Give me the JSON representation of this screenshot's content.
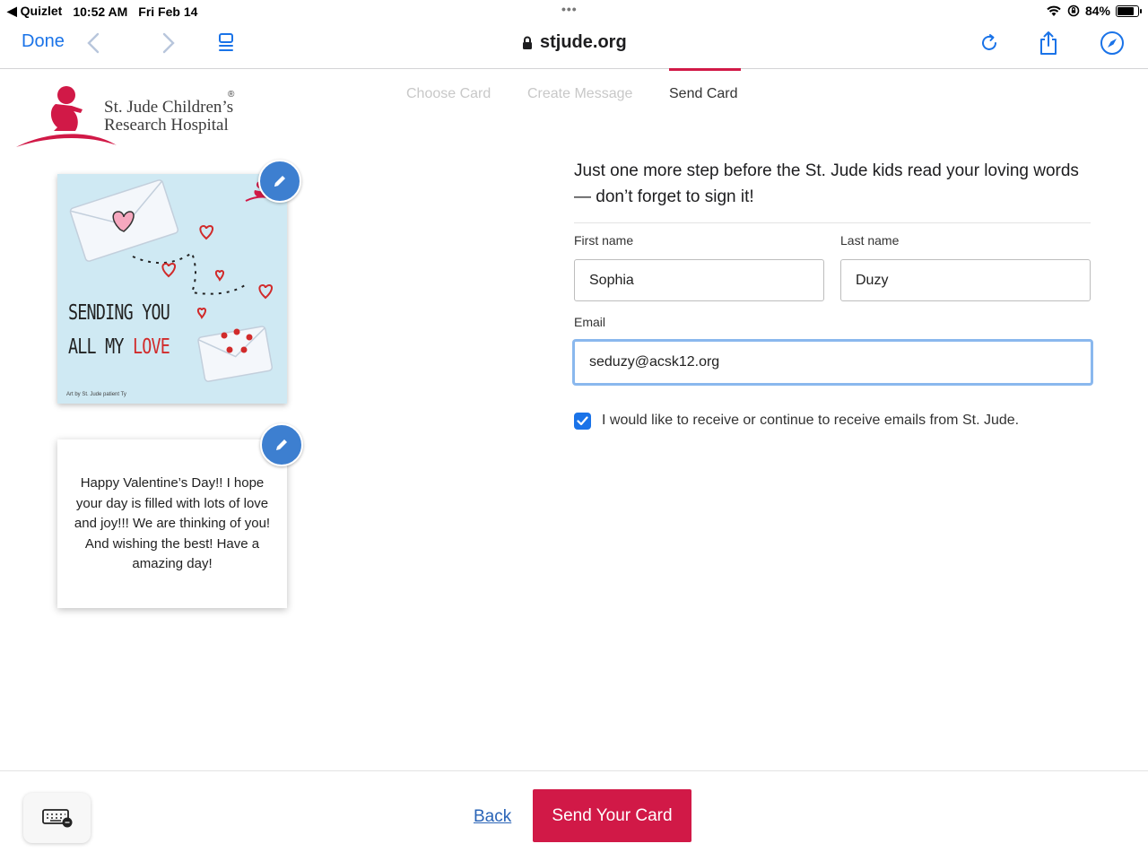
{
  "status_bar": {
    "back_app": "◀ Quizlet",
    "time": "10:52 AM",
    "date": "Fri Feb 14",
    "dots": "•••",
    "battery": "84%",
    "battery_level": 0.84
  },
  "browser": {
    "done_label": "Done",
    "url": "stjude.org"
  },
  "logo": {
    "line1": "St. Jude Children’s",
    "line2": "Research Hospital",
    "reg": "®"
  },
  "steps": [
    {
      "label": "Choose Card",
      "active": false
    },
    {
      "label": "Create Message",
      "active": false
    },
    {
      "label": "Send Card",
      "active": true
    }
  ],
  "card": {
    "front_line1": "SENDING YOU",
    "front_line2a": "ALL MY ",
    "front_line2b": "LOVE",
    "art_credit": "Art by St. Jude patient Ty",
    "message": "Happy Valentine’s Day!! I hope your day is filled with lots of love and joy!!! We are thinking of you! And wishing the best! Have a amazing day!"
  },
  "form": {
    "intro": "Just one more step before the St. Jude kids read your loving words — don’t forget to sign it!",
    "first_name_label": "First name",
    "first_name_value": "Sophia",
    "last_name_label": "Last name",
    "last_name_value": "Duzy",
    "email_label": "Email",
    "email_value": "seduzy@acsk12.org",
    "optin_label": "I would like to receive or continue to receive emails from St. Jude.",
    "optin_checked": true
  },
  "footer": {
    "back_label": "Back",
    "send_label": "Send Your Card"
  },
  "colors": {
    "brand_red": "#d11947",
    "link_blue": "#1a73e8",
    "edit_blue": "#3d7fd0"
  }
}
